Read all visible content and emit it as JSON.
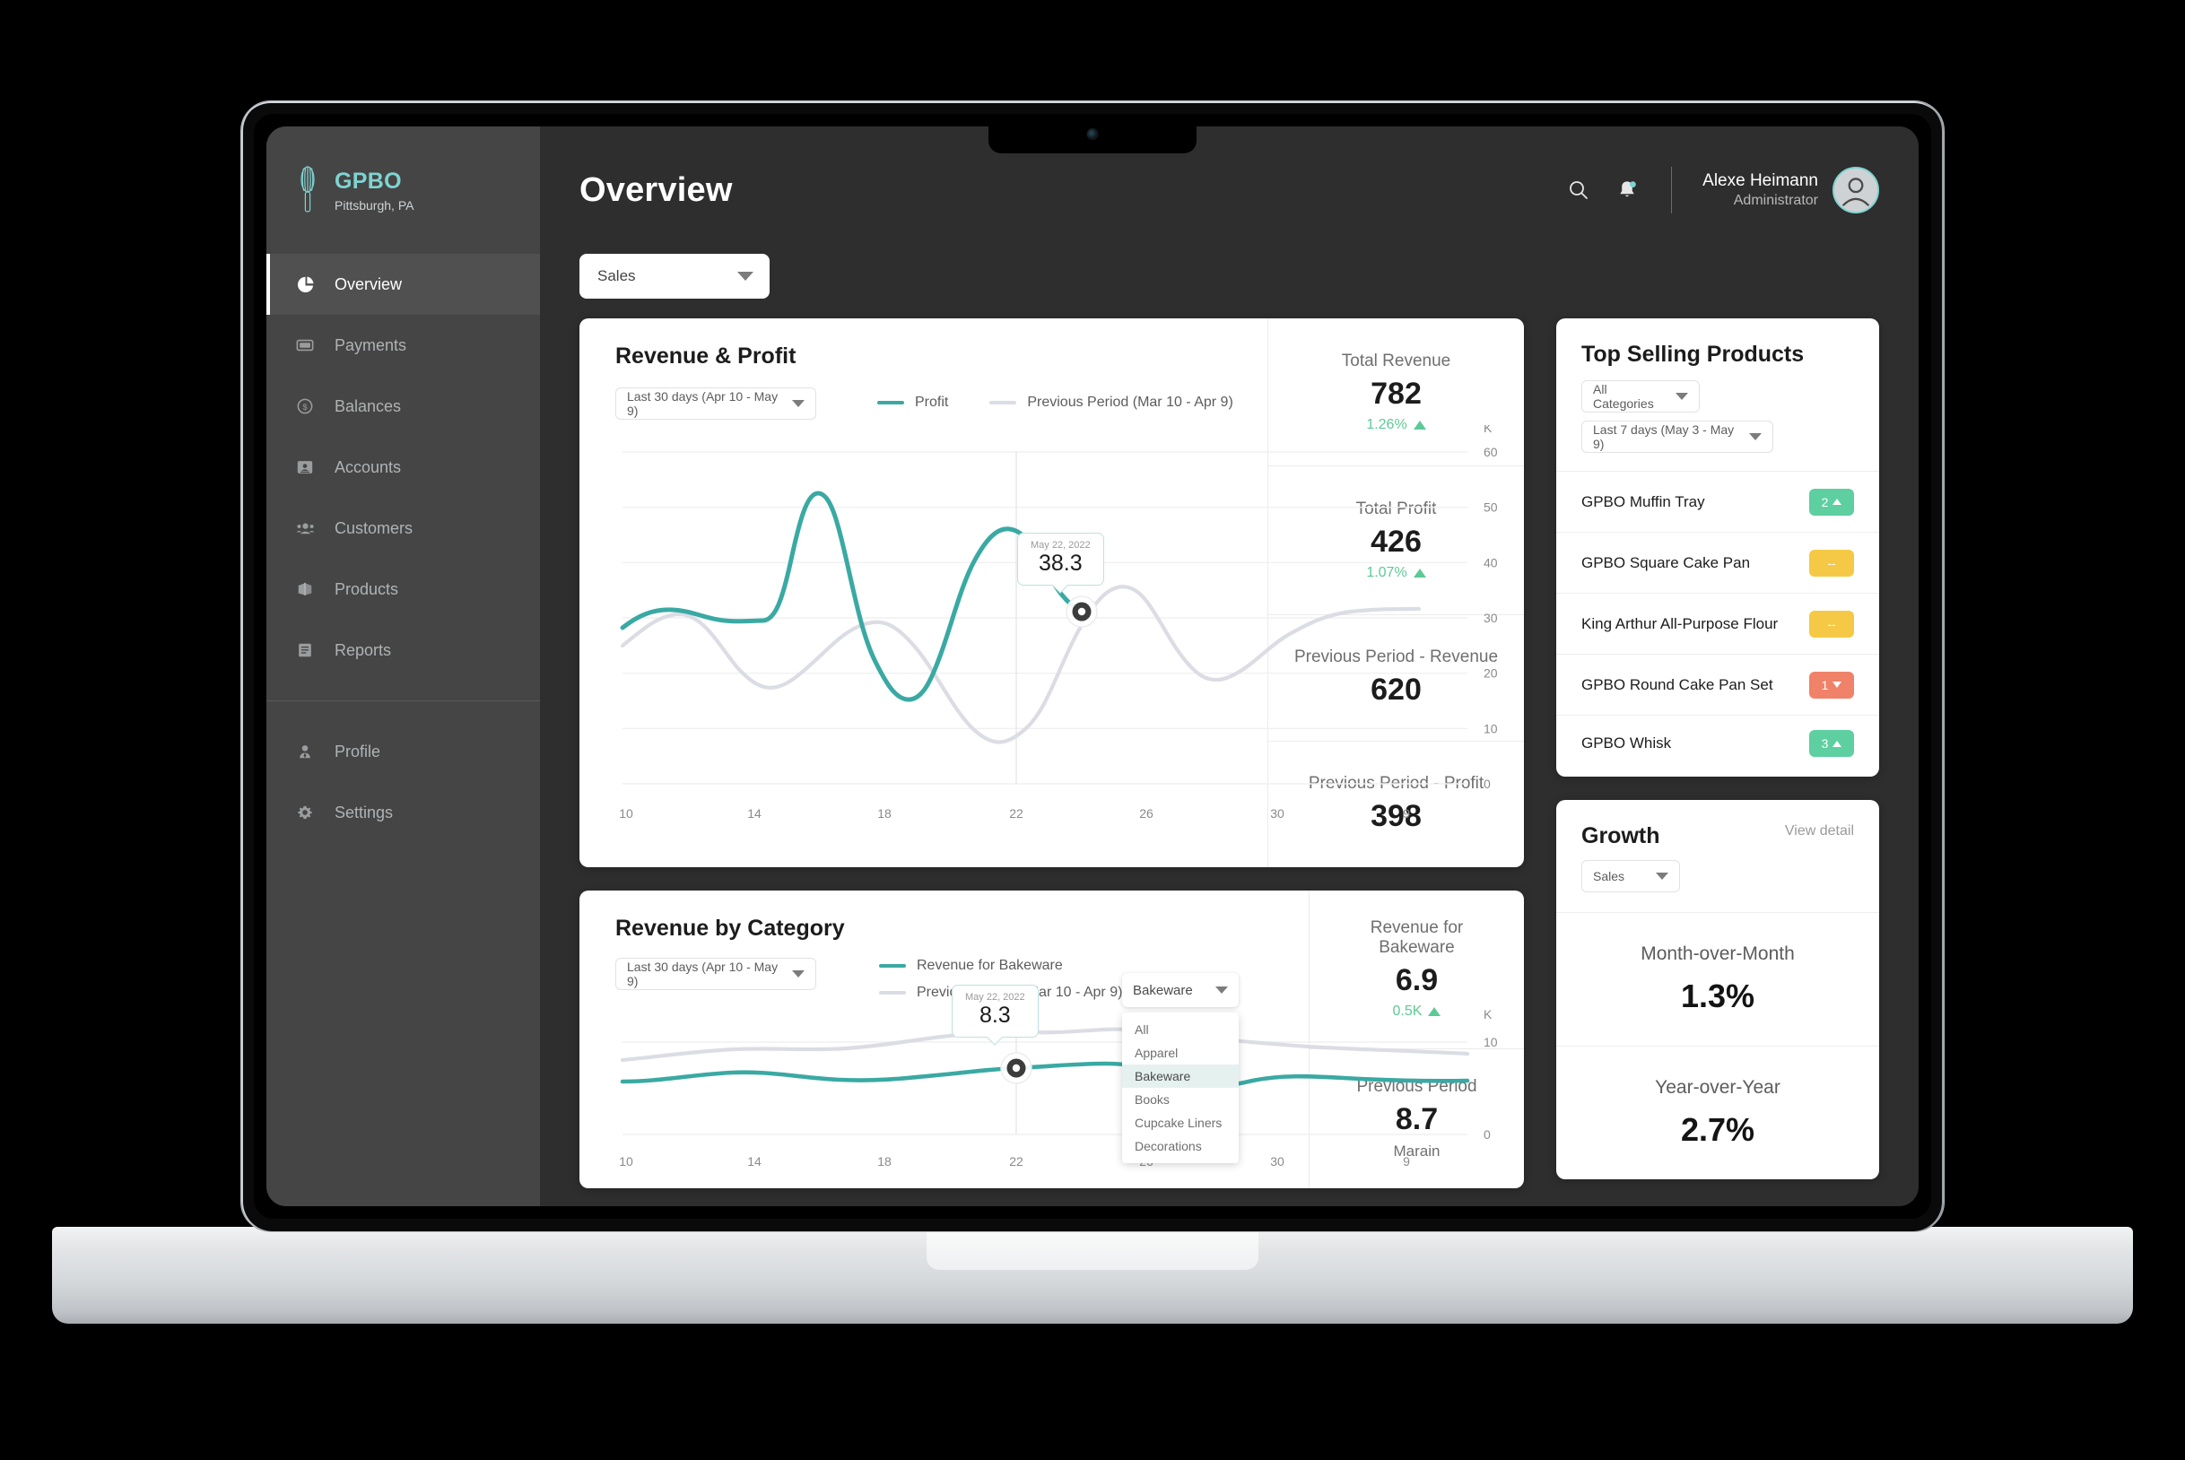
{
  "brand": {
    "name": "GPBO",
    "location": "Pittsburgh, PA",
    "icon": "whisk-icon"
  },
  "sidebar": {
    "items": [
      {
        "label": "Overview",
        "icon": "pie-chart-icon",
        "active": true
      },
      {
        "label": "Payments",
        "icon": "card-icon",
        "active": false
      },
      {
        "label": "Balances",
        "icon": "dollar-circle-icon",
        "active": false
      },
      {
        "label": "Accounts",
        "icon": "account-card-icon",
        "active": false
      },
      {
        "label": "Customers",
        "icon": "people-icon",
        "active": false
      },
      {
        "label": "Products",
        "icon": "box-icon",
        "active": false
      },
      {
        "label": "Reports",
        "icon": "report-icon",
        "active": false
      }
    ],
    "footer_items": [
      {
        "label": "Profile",
        "icon": "person-icon"
      },
      {
        "label": "Settings",
        "icon": "gear-icon"
      }
    ]
  },
  "topbar": {
    "title": "Overview",
    "search_icon": "search-icon",
    "notification_icon": "bell-icon",
    "user_name": "Alexe Heimann",
    "user_role": "Administrator",
    "avatar_icon": "avatar-icon"
  },
  "page_filter": {
    "value": "Sales"
  },
  "revenue_profit": {
    "title": "Revenue & Profit",
    "range": "Last 30 days (Apr 10 - May 9)",
    "legend": [
      {
        "label": "Profit",
        "color": "#3aa9a3"
      },
      {
        "label": "Previous Period (Mar 10 - Apr 9)",
        "color": "#dcdce4"
      }
    ],
    "tooltip": {
      "date": "May 22, 2022",
      "value": "38.3"
    },
    "stats": [
      {
        "label": "Total Revenue",
        "value": "782",
        "delta": "1.26%",
        "direction": "up"
      },
      {
        "label": "Total Profit",
        "value": "426",
        "delta": "1.07%",
        "direction": "up"
      },
      {
        "label": "Previous Period - Revenue",
        "value": "620"
      },
      {
        "label": "Previous Period - Profit",
        "value": "398"
      }
    ]
  },
  "revenue_by_category": {
    "title": "Revenue by Category",
    "range": "Last 30 days (Apr 10 - May 9)",
    "legend": [
      {
        "label": "Revenue for Bakeware",
        "color": "#3aa9a3"
      },
      {
        "label": "Previous Period (Mar 10 - Apr 9)",
        "color": "#dcdce4"
      }
    ],
    "tooltip": {
      "date": "May 22, 2022",
      "value": "8.3"
    },
    "category_dropdown": {
      "value": "Bakeware",
      "options": [
        "All",
        "Apparel",
        "Bakeware",
        "Books",
        "Cupcake Liners",
        "Decorations"
      ],
      "selected": "Bakeware"
    },
    "stats": [
      {
        "label_line1": "Revenue for",
        "label_line2": "Bakeware",
        "value": "6.9",
        "delta": "0.5K",
        "direction": "up"
      },
      {
        "label_line1": "Previous Period",
        "value": "8.7",
        "sub": "Marain"
      }
    ]
  },
  "top_selling": {
    "title": "Top Selling Products",
    "category_filter": "All Categories",
    "range_filter": "Last 7 days (May 3 - May 9)",
    "rows": [
      {
        "name": "GPBO Muffin Tray",
        "badge": "2",
        "direction": "up",
        "color": "#5ecfa0"
      },
      {
        "name": "GPBO Square Cake Pan",
        "badge": "--",
        "direction": "flat",
        "color": "#f5c945"
      },
      {
        "name": "King Arthur All-Purpose Flour",
        "badge": "--",
        "direction": "flat",
        "color": "#f5c945"
      },
      {
        "name": "GPBO Round Cake Pan Set",
        "badge": "1",
        "direction": "down",
        "color": "#ef8268"
      },
      {
        "name": "GPBO Whisk",
        "badge": "3",
        "direction": "up",
        "color": "#5ecfa0"
      }
    ]
  },
  "growth": {
    "title": "Growth",
    "view_detail": "View detail",
    "filter": "Sales",
    "blocks": [
      {
        "label": "Month-over-Month",
        "value": "1.3%"
      },
      {
        "label": "Year-over-Year",
        "value": "2.7%"
      }
    ]
  },
  "colors": {
    "accent": "#3aa9a3",
    "brand": "#7fd4d0",
    "positive": "#5dc996",
    "warning": "#f5c945",
    "negative": "#ef8268",
    "sidebar_bg": "#454545",
    "main_bg": "#2e2e2e"
  },
  "chart_data": [
    {
      "type": "line",
      "title": "Revenue & Profit",
      "xlabel": "",
      "ylabel": "K",
      "x_ticks": [
        "10",
        "14",
        "18",
        "22",
        "26",
        "30",
        "9"
      ],
      "y_ticks": [
        "0",
        "10",
        "20",
        "30",
        "40",
        "50",
        "60"
      ],
      "ylim": [
        0,
        63
      ],
      "grid": true,
      "legend_position": "top-right",
      "highlight": {
        "x": "22",
        "date": "May 22, 2022",
        "value": 38.3
      },
      "series": [
        {
          "name": "Profit",
          "color": "#3aa9a3",
          "x": [
            10,
            11,
            12,
            13,
            14,
            15,
            16,
            17,
            18,
            19,
            20,
            21,
            22
          ],
          "values": [
            28.5,
            30.2,
            30.0,
            29.5,
            51.5,
            33.0,
            18.5,
            17.5,
            30.0,
            44.5,
            45.0,
            41.0,
            38.3
          ]
        },
        {
          "name": "Previous Period (Mar 10 - Apr 9)",
          "color": "#dcdce4",
          "x": [
            10,
            11,
            12,
            13,
            14,
            15,
            16,
            17,
            18,
            19,
            20,
            21,
            22,
            23,
            24,
            25,
            26,
            27,
            28,
            29,
            30,
            31
          ],
          "values": [
            28.5,
            33.0,
            31.5,
            27.0,
            23.5,
            24.5,
            29.5,
            34.5,
            35.0,
            31.5,
            26.0,
            20.0,
            17.5,
            20.0,
            29.0,
            42.5,
            43.0,
            33.5,
            29.5,
            30.5,
            35.5,
            38.5
          ]
        }
      ]
    },
    {
      "type": "line",
      "title": "Revenue by Category",
      "xlabel": "",
      "ylabel": "K",
      "x_ticks": [
        "10",
        "14",
        "18",
        "22",
        "26",
        "30",
        "9"
      ],
      "y_ticks": [
        "0",
        "10"
      ],
      "ylim": [
        0,
        13
      ],
      "grid": true,
      "legend_position": "top-right",
      "highlight": {
        "x": "22",
        "date": "May 22, 2022",
        "value": 8.3
      },
      "series": [
        {
          "name": "Revenue for Bakeware",
          "color": "#3aa9a3",
          "x": [
            10,
            12,
            14,
            16,
            18,
            20,
            22,
            24,
            26,
            28,
            30,
            32
          ],
          "values": [
            6.6,
            6.9,
            7.5,
            7.0,
            6.8,
            6.9,
            8.3,
            8.5,
            8.0,
            6.5,
            7.2,
            6.8
          ]
        },
        {
          "name": "Previous Period (Mar 10 - Apr 9)",
          "color": "#dcdce4",
          "x": [
            10,
            12,
            14,
            16,
            18,
            20,
            22,
            24,
            26,
            28,
            30,
            32
          ],
          "values": [
            8.2,
            9.2,
            9.4,
            9.6,
            10.4,
            9.8,
            11.0,
            11.8,
            11.5,
            10.3,
            9.8,
            9.4
          ]
        }
      ]
    }
  ]
}
